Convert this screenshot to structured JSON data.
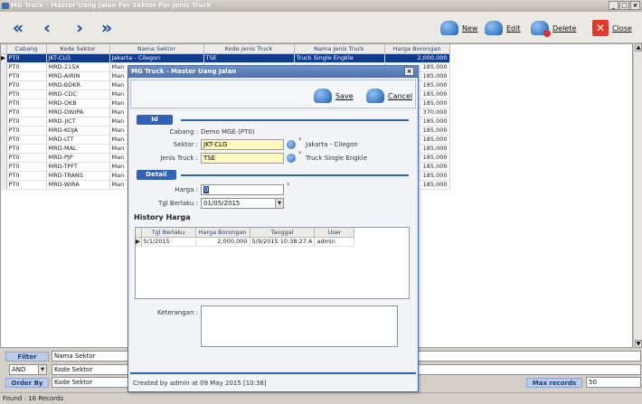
{
  "window": {
    "title": "MG Truck - Master Uang Jalan Per Sektor Per Jenis Truck",
    "min": "_",
    "max": "□",
    "close": "×"
  },
  "toolbar": {
    "first": "«",
    "prev": "‹",
    "next": "›",
    "last": "»",
    "new_label": "New",
    "edit_label": "Edit",
    "delete_label": "Delete",
    "close_label": "Close"
  },
  "grid": {
    "columns": [
      "Cabang",
      "Kode Sektor",
      "Nama Sektor",
      "Kode Jenis Truck",
      "Nama Jenis Truck",
      "Harga Borongan"
    ],
    "rows": [
      [
        "PT0",
        "JKT-CLG",
        "Jakarta - Cilegon",
        "TSE",
        "Truck Single Engkle",
        "2,000,000"
      ],
      [
        "PT0",
        "MRD-215X",
        "Man",
        "",
        "",
        "185,000"
      ],
      [
        "PT0",
        "MRD-AIRIN",
        "Man",
        "",
        "",
        "185,000"
      ],
      [
        "PT0",
        "MRD-BDKR",
        "Man",
        "",
        "",
        "185,000"
      ],
      [
        "PT0",
        "MRD-CDC",
        "Man",
        "",
        "",
        "185,000"
      ],
      [
        "PT0",
        "MRD-DKB",
        "Man",
        "",
        "",
        "185,000"
      ],
      [
        "PT0",
        "MRD-DWIPA",
        "Man",
        "",
        "",
        "370,000"
      ],
      [
        "PT0",
        "MRD-JICT",
        "Man",
        "",
        "",
        "185,000"
      ],
      [
        "PT0",
        "MRD-KOJA",
        "Man",
        "",
        "",
        "185,000"
      ],
      [
        "PT0",
        "MRD-LTT",
        "Man",
        "",
        "",
        "185,000"
      ],
      [
        "PT0",
        "MRD-MAL",
        "Man",
        "",
        "",
        "185,000"
      ],
      [
        "PT0",
        "MRD-PJP",
        "Man",
        "",
        "",
        "185,000"
      ],
      [
        "PT0",
        "MRD-TPFT",
        "Man",
        "",
        "",
        "185,000"
      ],
      [
        "PT0",
        "MRD-TRANS",
        "Man",
        "",
        "",
        "185,000"
      ],
      [
        "PT0",
        "MRD-WIRA",
        "Man",
        "",
        "",
        "185,000"
      ]
    ]
  },
  "filter": {
    "filter_label": "Filter",
    "filter_value": "Nama Sektor",
    "op_value": "AND",
    "op_field": "Kode Sektor",
    "order_label": "Order By",
    "order_value": "Kode Sektor",
    "max_label": "Max records",
    "max_value": "50"
  },
  "status": {
    "text": "Found : 16 Records"
  },
  "modal": {
    "title": "MG Truck - Master Uang Jalan",
    "close": "×",
    "save_label": "Save",
    "cancel_label": "Cancel",
    "id_section": "Id",
    "cabang_label": "Cabang :",
    "cabang_value": "Demo MGE (PT0)",
    "sektor_label": "Sektor :",
    "sektor_value": "JKT-CLG",
    "sektor_name": "Jakarta - Cilegon",
    "jenis_label": "Jenis Truck :",
    "jenis_value": "TSE",
    "jenis_name": "Truck Single Engkle",
    "detail_section": "Detail",
    "harga_label": "Harga :",
    "harga_value": "0",
    "tgl_label": "Tgl Berlaku :",
    "tgl_value": "01/05/2015",
    "history_title": "History Harga",
    "history_columns": [
      "Tgl Berlaku",
      "Harga Borongan",
      "Tanggal",
      "User"
    ],
    "history_rows": [
      [
        "5/1/2015",
        "2,000,000",
        "5/9/2015 10:38:27 A",
        "admin"
      ]
    ],
    "keterangan_label": "Keterangan :",
    "footer": "Created by admin at 09 May 2015 [10:38]",
    "required_mark": "*"
  }
}
